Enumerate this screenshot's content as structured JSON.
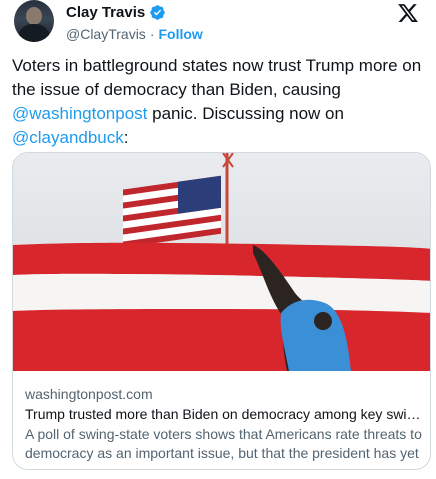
{
  "author": {
    "display_name": "Clay Travis",
    "handle": "@ClayTravis",
    "separator": "·",
    "follow_label": "Follow",
    "verified_icon": "verified-badge-icon",
    "avatar": "profile-photo"
  },
  "brand": {
    "logo": "x-logo-icon"
  },
  "tweet": {
    "text_part1": "Voters in battleground states now trust Trump more on the issue of democracy than Biden, causing ",
    "mention1": "@washingtonpost",
    "text_part2": " panic. Discussing now on ",
    "mention2": "@clayandbuck",
    "text_part3": ":"
  },
  "link_card": {
    "domain": "washingtonpost.com",
    "title": "Trump trusted more than Biden on democracy among key swing…",
    "description": "A poll of swing-state voters shows that Americans rate threats to democracy as an important issue, but that the president has yet …",
    "image": "photo of a person raising a large American flag banner"
  },
  "colors": {
    "link_blue": "#1d9bf0",
    "text_primary": "#0f1419",
    "text_secondary": "#536471",
    "border": "#cfd9de",
    "flag_red": "#d7262c"
  }
}
